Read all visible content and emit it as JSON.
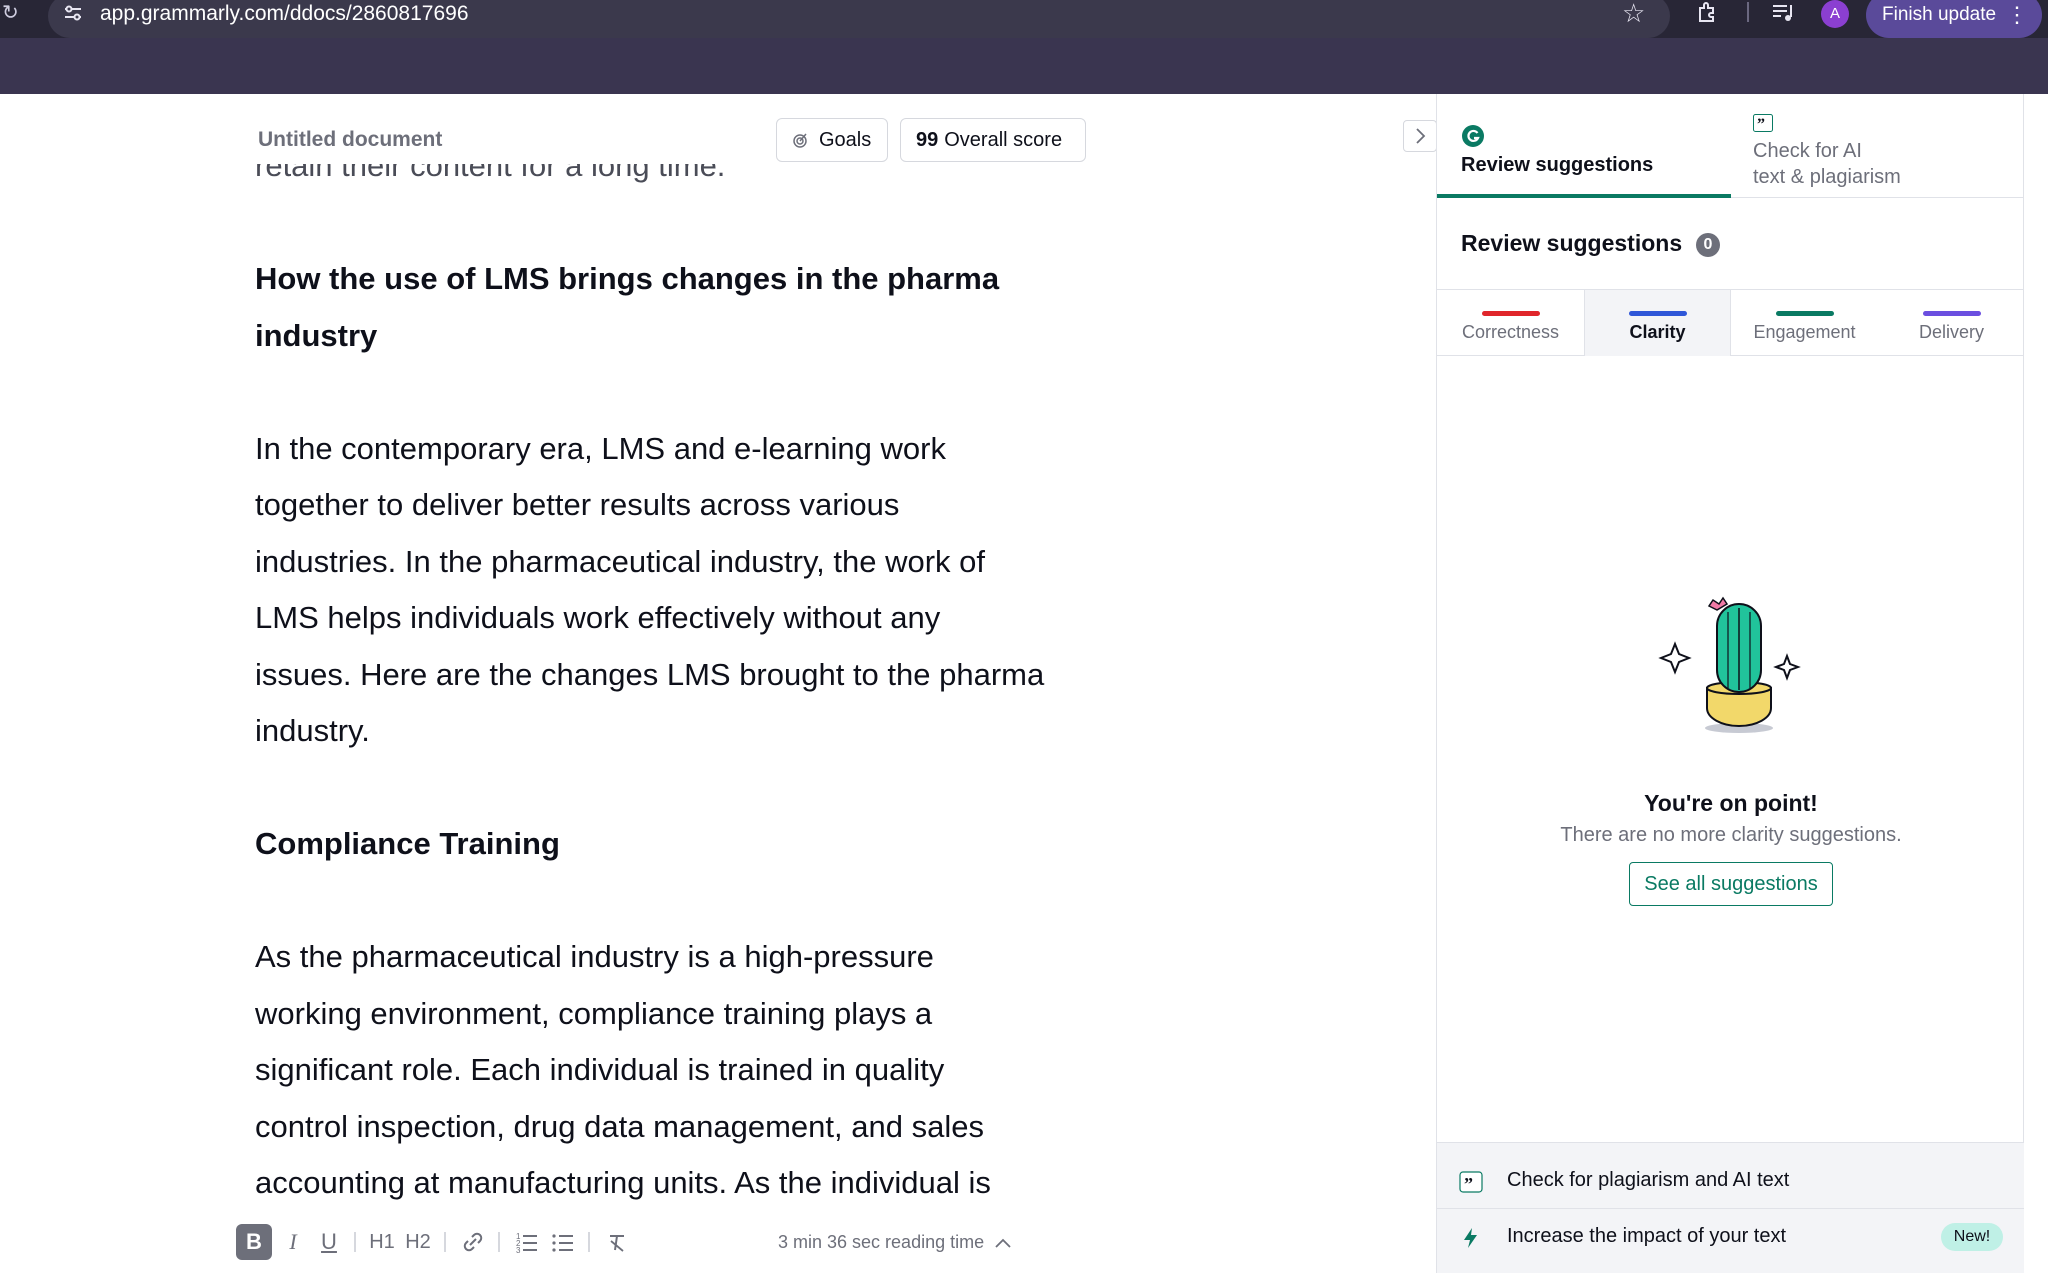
{
  "browser": {
    "url": "app.grammarly.com/ddocs/2860817696",
    "profile_initial": "A",
    "finish_update_label": "Finish update"
  },
  "header": {
    "doc_title": "Untitled document",
    "goals_label": "Goals",
    "score_value": "99",
    "score_label": "Overall score"
  },
  "document": {
    "cut_line": "retain their content for a long time.",
    "heading1_line1": "How the use of  LMS brings changes in the pharma",
    "heading1_line2": "industry",
    "para1": [
      "In the contemporary era, LMS and e-learning work",
      "together to deliver better results across various",
      "industries. In the pharmaceutical industry, the work of",
      "LMS helps individuals work effectively without any",
      "issues. Here are the changes LMS brought to the pharma",
      "industry."
    ],
    "heading2": "Compliance Training",
    "para2": [
      "As the pharmaceutical industry is a high-pressure",
      "working environment, compliance training plays a",
      "significant role. Each individual is trained in quality",
      "control inspection, drug data management, and sales",
      "accounting at manufacturing units. As the individual is"
    ]
  },
  "toolbar": {
    "bold": "B",
    "italic": "I",
    "underline": "U",
    "h1": "H1",
    "h2": "H2",
    "reading_time": "3 min 36 sec reading time"
  },
  "panel": {
    "tab_review": "Review suggestions",
    "tab_ai_line1": "Check for AI",
    "tab_ai_line2": "text & plagiarism",
    "title": "Review suggestions",
    "count": "0",
    "categories": [
      {
        "name": "Correctness",
        "color": "#e0262b"
      },
      {
        "name": "Clarity",
        "color": "#2f57d8"
      },
      {
        "name": "Engagement",
        "color": "#0a7a63"
      },
      {
        "name": "Delivery",
        "color": "#6b4fe0"
      }
    ],
    "empty_title": "You're on point!",
    "empty_sub": "There are no more clarity suggestions.",
    "see_all": "See all suggestions",
    "footer_plagiarism": "Check for plagiarism and AI text",
    "footer_impact": "Increase the impact of your text",
    "new_badge": "New!"
  },
  "colors": {
    "accent": "#0a7a63",
    "chrome_bg": "#3a3550"
  }
}
